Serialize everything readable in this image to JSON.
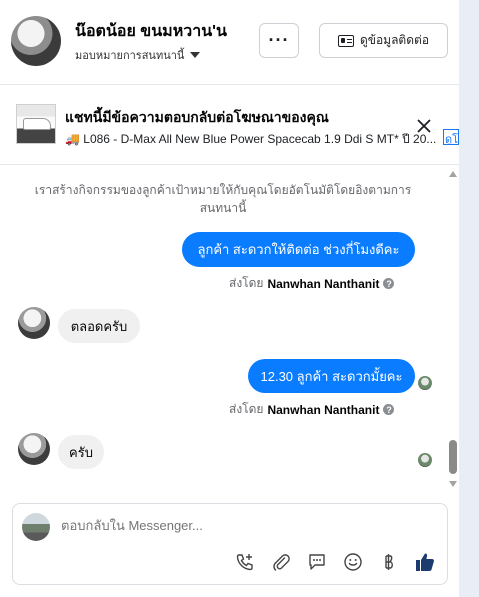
{
  "header": {
    "name": "น๊อตน้อย ขนมหวาน'น",
    "subtitle": "มอบหมายการสนทนานี้",
    "more_label": "···",
    "contact_label": "ดูข้อมูลติดต่อ"
  },
  "ad": {
    "title": "แชทนี้มีข้อความตอบกลับต่อโฆษณาของคุณ",
    "subtitle": "🚚 L086 - D-Max All New Blue Power Spacecab 1.9 Ddi S MT* ปี 20...",
    "link_label": "ดูโ"
  },
  "conversation": {
    "info": "เราสร้างกิจกรรมของลูกค้าเป้าหมายให้กับคุณโดยอัตโนมัติโดยอิงตามการสนทนานี้",
    "messages": [
      {
        "text": "ลูกค้า  สะดวกให้ติดต่อ ช่วงกี่โมงดีคะ",
        "sent_by_prefix": "ส่งโดย",
        "sent_by_name": "Nanwhan Nanthanit"
      },
      {
        "text": "ตลอดครับ"
      },
      {
        "text": "12.30 ลูกค้า สะดวกมั้ยคะ",
        "sent_by_prefix": "ส่งโดย",
        "sent_by_name": "Nanwhan Nanthanit"
      },
      {
        "text": "ครับ"
      }
    ]
  },
  "composer": {
    "placeholder": "ตอบกลับใน Messenger...",
    "tools": [
      "phone-add-icon",
      "attachment-icon",
      "saved-reply-icon",
      "emoji-icon",
      "baht-icon",
      "like-icon"
    ]
  },
  "colors": {
    "accent": "#0a7cff",
    "bubble_in": "#f0f0f0",
    "like": "#1877f2"
  }
}
